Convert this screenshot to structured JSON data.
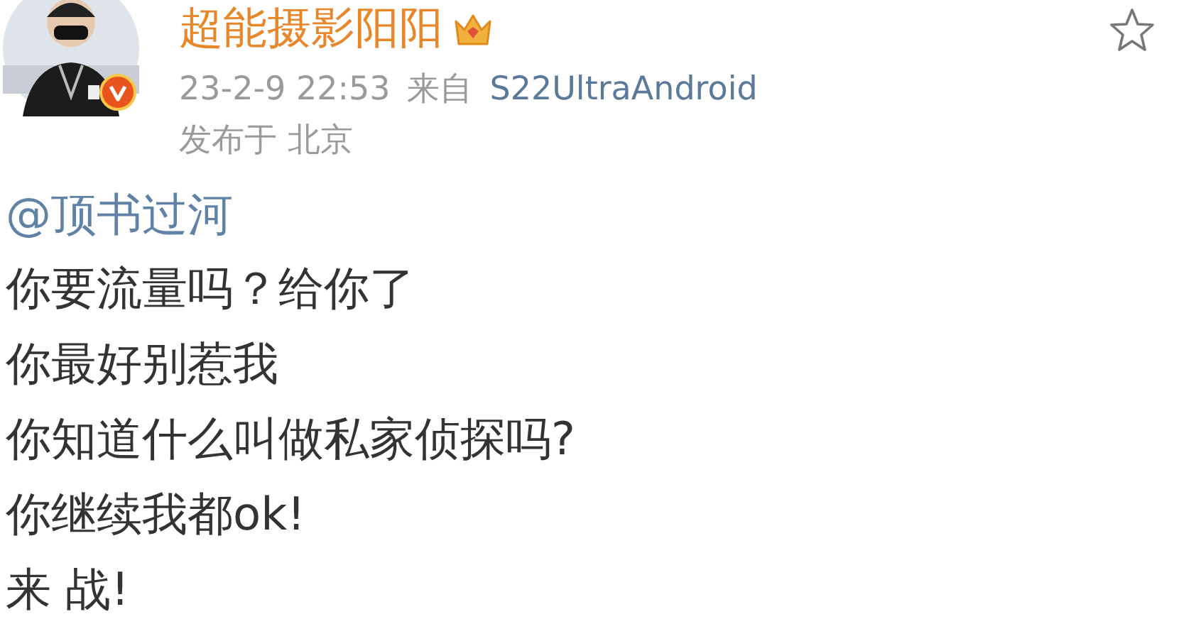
{
  "author": {
    "name": "超能摄影阳阳",
    "verified": true,
    "vip": true
  },
  "meta": {
    "time": "23-2-9 22:53",
    "source_prefix": "来自",
    "source": "S22UltraAndroid",
    "location": "发布于 北京"
  },
  "favorite": {
    "selected": false
  },
  "post": {
    "mention": "@顶书过河",
    "lines": [
      "你要流量吗？给你了",
      "你最好别惹我",
      "你知道什么叫做私家侦探吗?",
      "你继续我都ok!",
      "来 战!"
    ]
  }
}
